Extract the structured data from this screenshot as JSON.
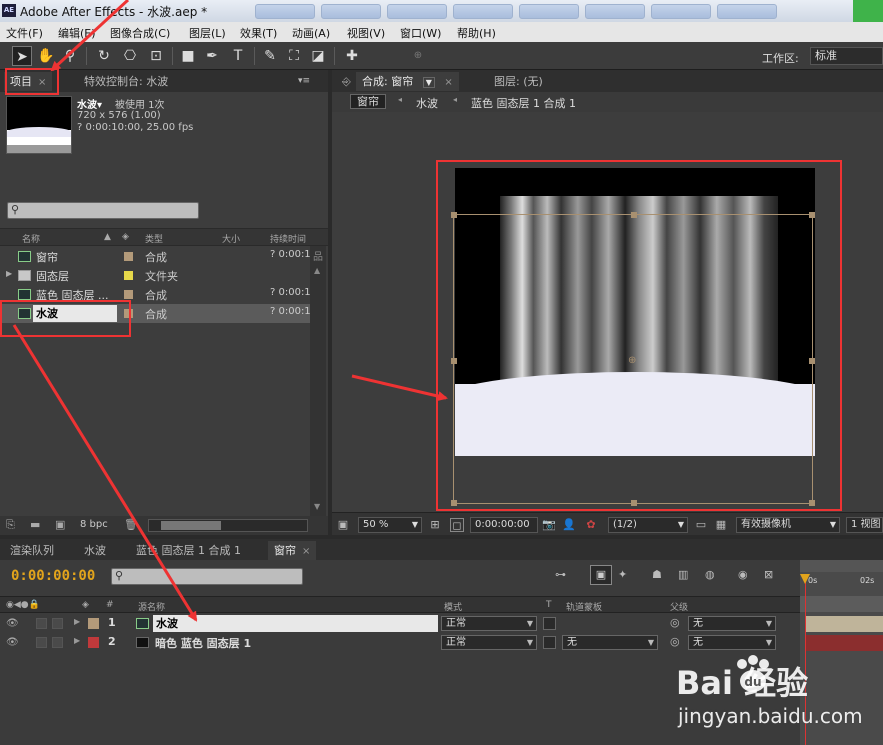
{
  "window": {
    "title": "Adobe After Effects - 水波.aep *",
    "logo": "AE"
  },
  "menu": [
    "文件(F)",
    "编辑(E)",
    "图像合成(C)",
    "图层(L)",
    "效果(T)",
    "动画(A)",
    "视图(V)",
    "窗口(W)",
    "帮助(H)"
  ],
  "toolbar": {
    "tools": [
      "selection-arrow-icon",
      "hand-icon",
      "zoom-icon",
      "rotate-icon",
      "camera-orbit-icon",
      "pan-behind-icon",
      "rectangle-mask-icon",
      "pen-icon",
      "text-icon",
      "brush-icon",
      "clone-stamp-icon",
      "eraser-icon",
      "puppet-pin-icon"
    ],
    "workspace_label": "工作区:",
    "workspace_value": "标准"
  },
  "project": {
    "tabs": [
      {
        "label": "项目",
        "close": "×"
      },
      {
        "label": "特效控制台: 水波",
        "close": ""
      }
    ],
    "info": {
      "name": "水波▾",
      "used": "被使用 1次",
      "size": "720 x 576 (1.00)",
      "duration": "? 0:00:10:00, 25.00 fps"
    },
    "columns": [
      "名称",
      "类型",
      "大小",
      "持续时间"
    ],
    "items": [
      {
        "name": "窗帘",
        "type": "合成",
        "duration": "? 0:00:1",
        "label_color": "#b39a7a",
        "kind": "comp"
      },
      {
        "name": "固态层",
        "type": "文件夹",
        "duration": "",
        "label_color": "#e6d84a",
        "kind": "folder"
      },
      {
        "name": "蓝色 固态层 ...",
        "type": "合成",
        "duration": "? 0:00:1",
        "label_color": "#b39a7a",
        "kind": "comp"
      },
      {
        "name": "水波",
        "type": "合成",
        "duration": "? 0:00:1",
        "label_color": "#b39a7a",
        "kind": "comp"
      }
    ],
    "footer": {
      "bpc": "8 bpc"
    }
  },
  "comp": {
    "tabs": [
      {
        "label": "合成: 窗帘",
        "close": "×"
      },
      {
        "label": "图层: (无)",
        "close": ""
      }
    ],
    "breadcrumbs": [
      "窗帘",
      "水波",
      "蓝色 固态层 1 合成 1"
    ],
    "footer": {
      "zoom": "50 %",
      "timecode": "0:00:00:00",
      "resolution": "(1/2)",
      "camera": "有效摄像机",
      "views": "1 视图"
    }
  },
  "timeline": {
    "tabs": [
      {
        "label": "渲染队列",
        "close": ""
      },
      {
        "label": "水波",
        "close": ""
      },
      {
        "label": "蓝色 固态层 1 合成 1",
        "close": ""
      },
      {
        "label": "窗帘",
        "close": "×"
      }
    ],
    "timecode": "0:00:00:00",
    "columns": {
      "num": "#",
      "source": "源名称",
      "mode": "模式",
      "t": "T",
      "track": "轨道蒙板",
      "parent": "父级"
    },
    "layers": [
      {
        "num": "1",
        "name": "水波",
        "mode": "正常",
        "track": "",
        "parent": "无",
        "label_color": "#b39a7a",
        "kind": "comp"
      },
      {
        "num": "2",
        "name": "暗色 蓝色 固态层 1",
        "mode": "正常",
        "track": "无",
        "parent": "无",
        "label_color": "#c0393b",
        "kind": "solid"
      }
    ],
    "ruler": {
      "t0": "0s",
      "t2": "02s"
    }
  },
  "watermark": {
    "logo": "Bai  经验",
    "url": "jingyan.baidu.com"
  }
}
